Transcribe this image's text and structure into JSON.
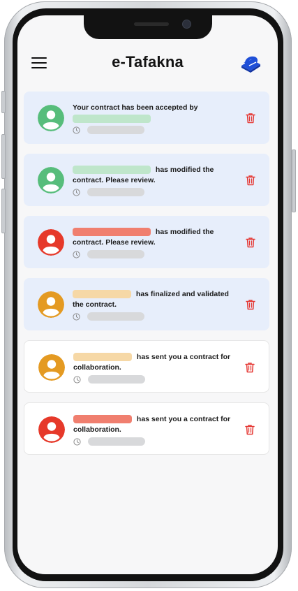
{
  "app": {
    "title": "e-Tafakna"
  },
  "colors": {
    "green": "#57bd7b",
    "green_pill": "#bfe6cb",
    "red": "#e6392a",
    "red_pill": "#f07f6f",
    "orange": "#e49a22",
    "orange_pill": "#f6d8a6",
    "unread_bg": "#e7eefb",
    "trash": "#e53935"
  },
  "notifications": [
    {
      "prefix": "Your contract has been accepted by",
      "suffix": "",
      "avatar_color": "#57bd7b",
      "pill_color": "#bfe6cb",
      "unread": true
    },
    {
      "prefix": "",
      "suffix": "has modified the contract. Please review.",
      "avatar_color": "#57bd7b",
      "pill_color": "#bfe6cb",
      "unread": true
    },
    {
      "prefix": "",
      "suffix": "has modified the contract. Please review.",
      "avatar_color": "#e6392a",
      "pill_color": "#f07f6f",
      "unread": true
    },
    {
      "prefix": "",
      "suffix": "has finalized and validated the contract.",
      "avatar_color": "#e49a22",
      "pill_color": "#f6d8a6",
      "unread": true
    },
    {
      "prefix": "",
      "suffix": "has sent you a contract for collaboration.",
      "avatar_color": "#e49a22",
      "pill_color": "#f6d8a6",
      "unread": false
    },
    {
      "prefix": "",
      "suffix": "has sent you a contract for collaboration.",
      "avatar_color": "#e6392a",
      "pill_color": "#f07f6f",
      "unread": false
    }
  ]
}
